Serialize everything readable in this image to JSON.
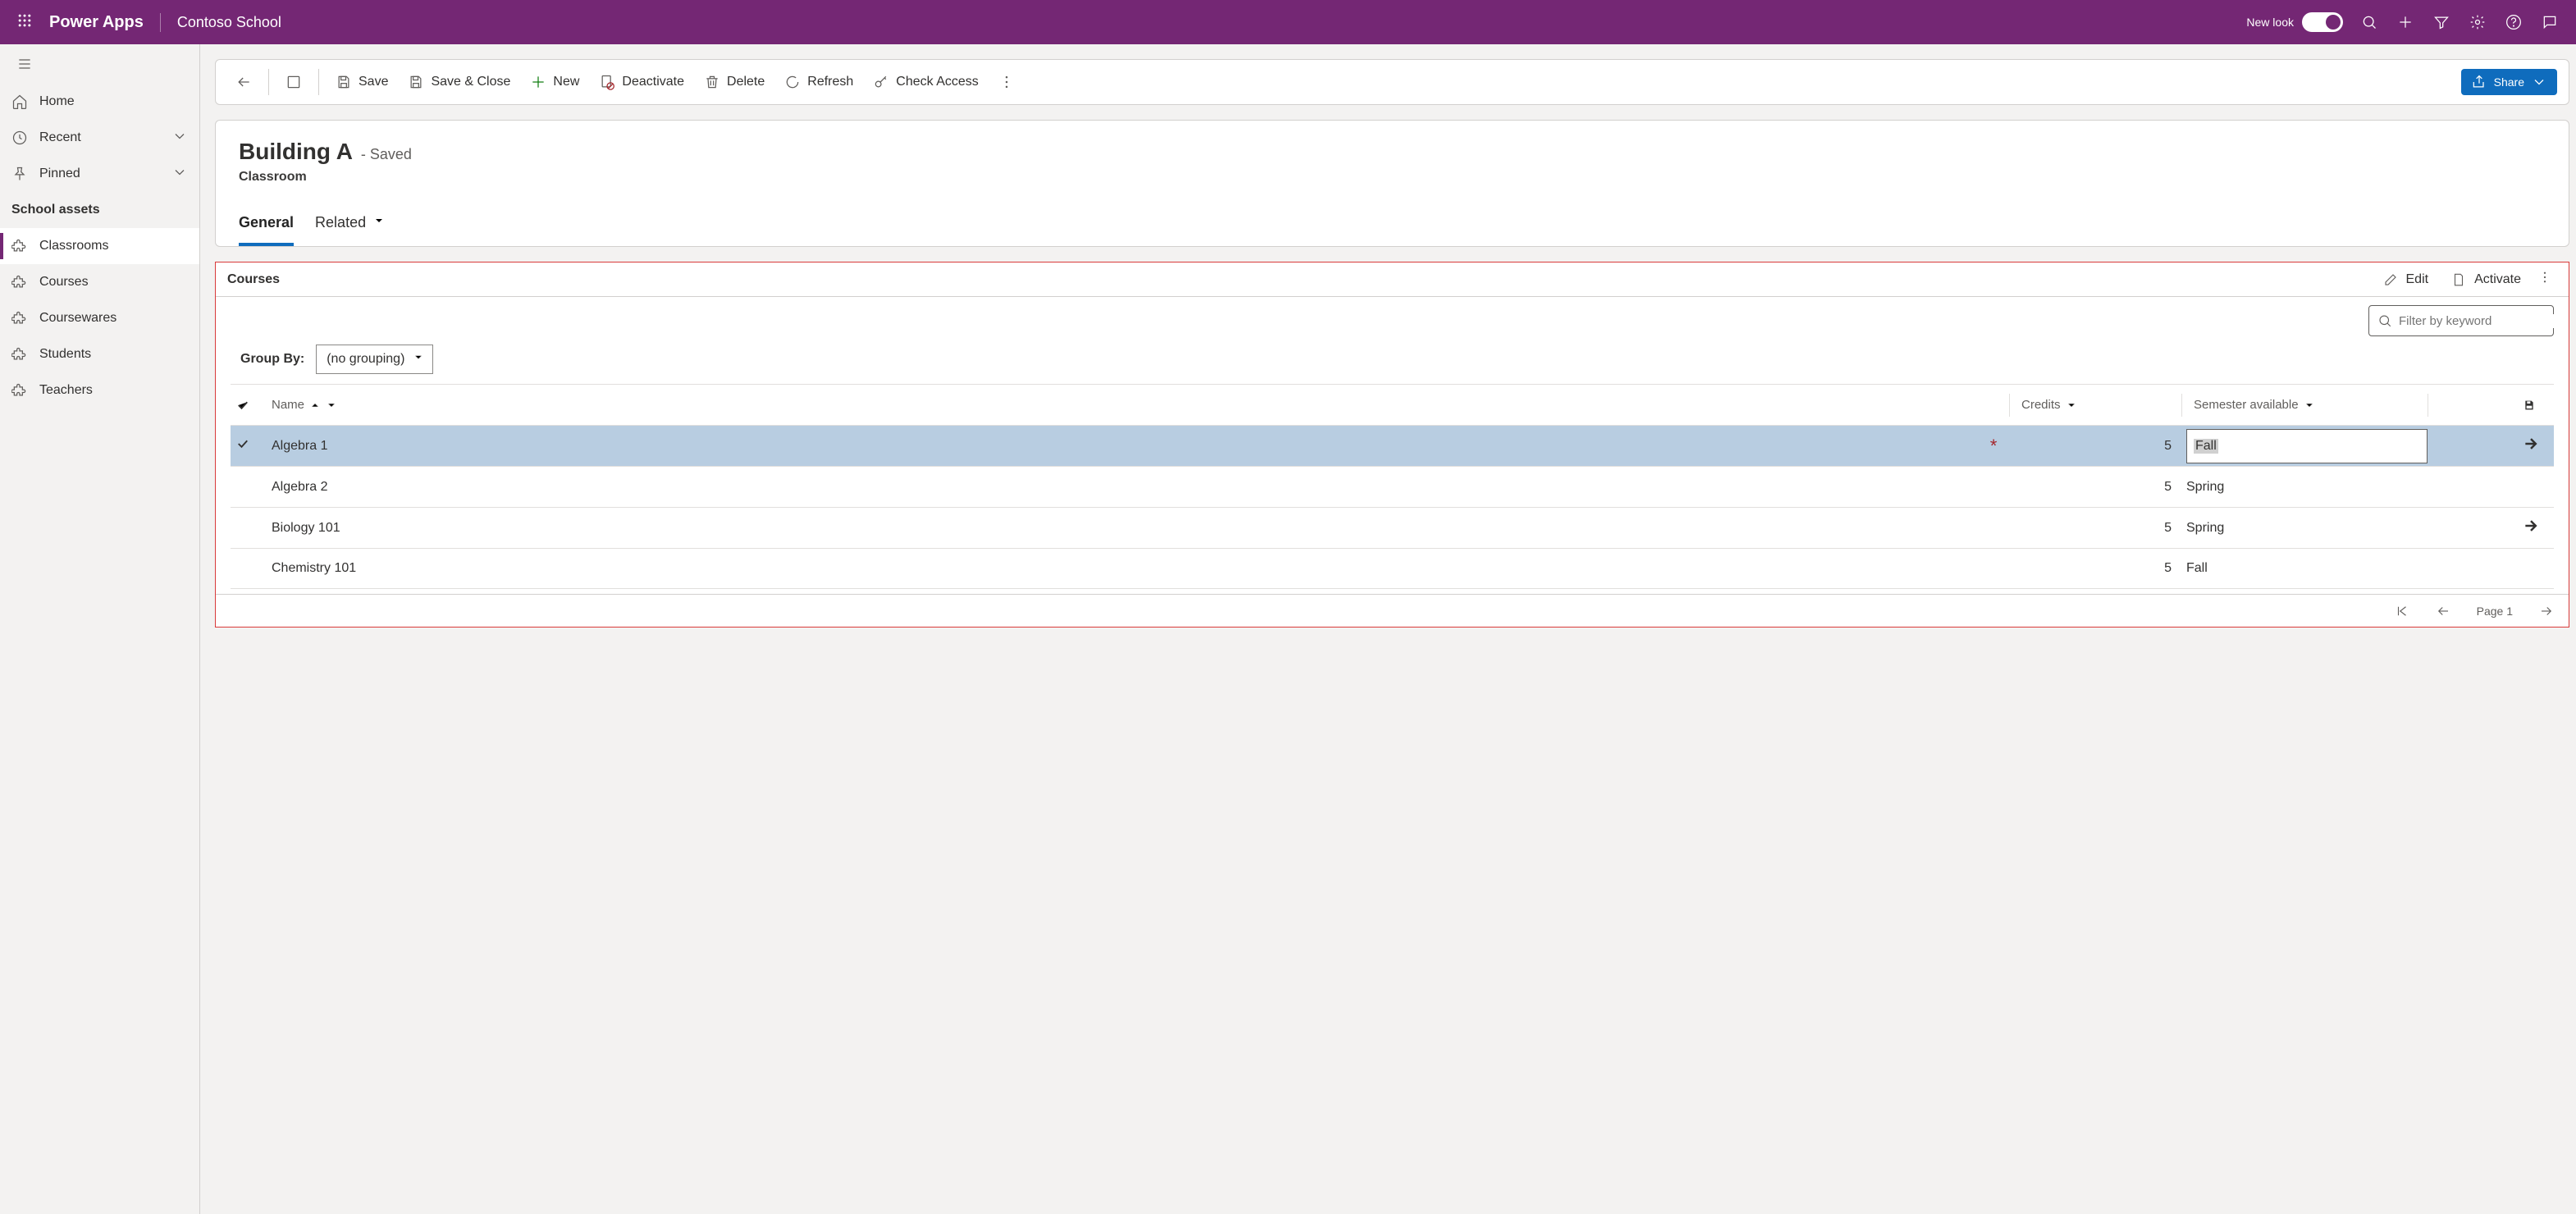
{
  "topbar": {
    "app_name": "Power Apps",
    "environment": "Contoso School",
    "new_look_label": "New look"
  },
  "nav": {
    "home": "Home",
    "recent": "Recent",
    "pinned": "Pinned",
    "group_title": "School assets",
    "items": [
      "Classrooms",
      "Courses",
      "Coursewares",
      "Students",
      "Teachers"
    ],
    "active_index": 0
  },
  "commandbar": {
    "save": "Save",
    "save_close": "Save & Close",
    "new": "New",
    "deactivate": "Deactivate",
    "delete": "Delete",
    "refresh": "Refresh",
    "check_access": "Check Access",
    "share": "Share"
  },
  "record": {
    "title": "Building A",
    "status": "- Saved",
    "entity": "Classroom",
    "tabs": {
      "general": "General",
      "related": "Related"
    }
  },
  "subgrid": {
    "title": "Courses",
    "edit": "Edit",
    "activate": "Activate",
    "filter_placeholder": "Filter by keyword",
    "groupby_label": "Group By:",
    "groupby_value": "(no grouping)",
    "columns": {
      "name": "Name",
      "credits": "Credits",
      "semester": "Semester available"
    },
    "rows": [
      {
        "name": "Algebra 1",
        "credits": "5",
        "semester": "Fall",
        "selected": true,
        "editing_semester": true,
        "required": true,
        "has_nav": true
      },
      {
        "name": "Algebra 2",
        "credits": "5",
        "semester": "Spring",
        "selected": false
      },
      {
        "name": "Biology 101",
        "credits": "5",
        "semester": "Spring",
        "selected": false,
        "has_nav": true
      },
      {
        "name": "Chemistry 101",
        "credits": "5",
        "semester": "Fall",
        "selected": false
      }
    ],
    "pager": "Page 1"
  }
}
